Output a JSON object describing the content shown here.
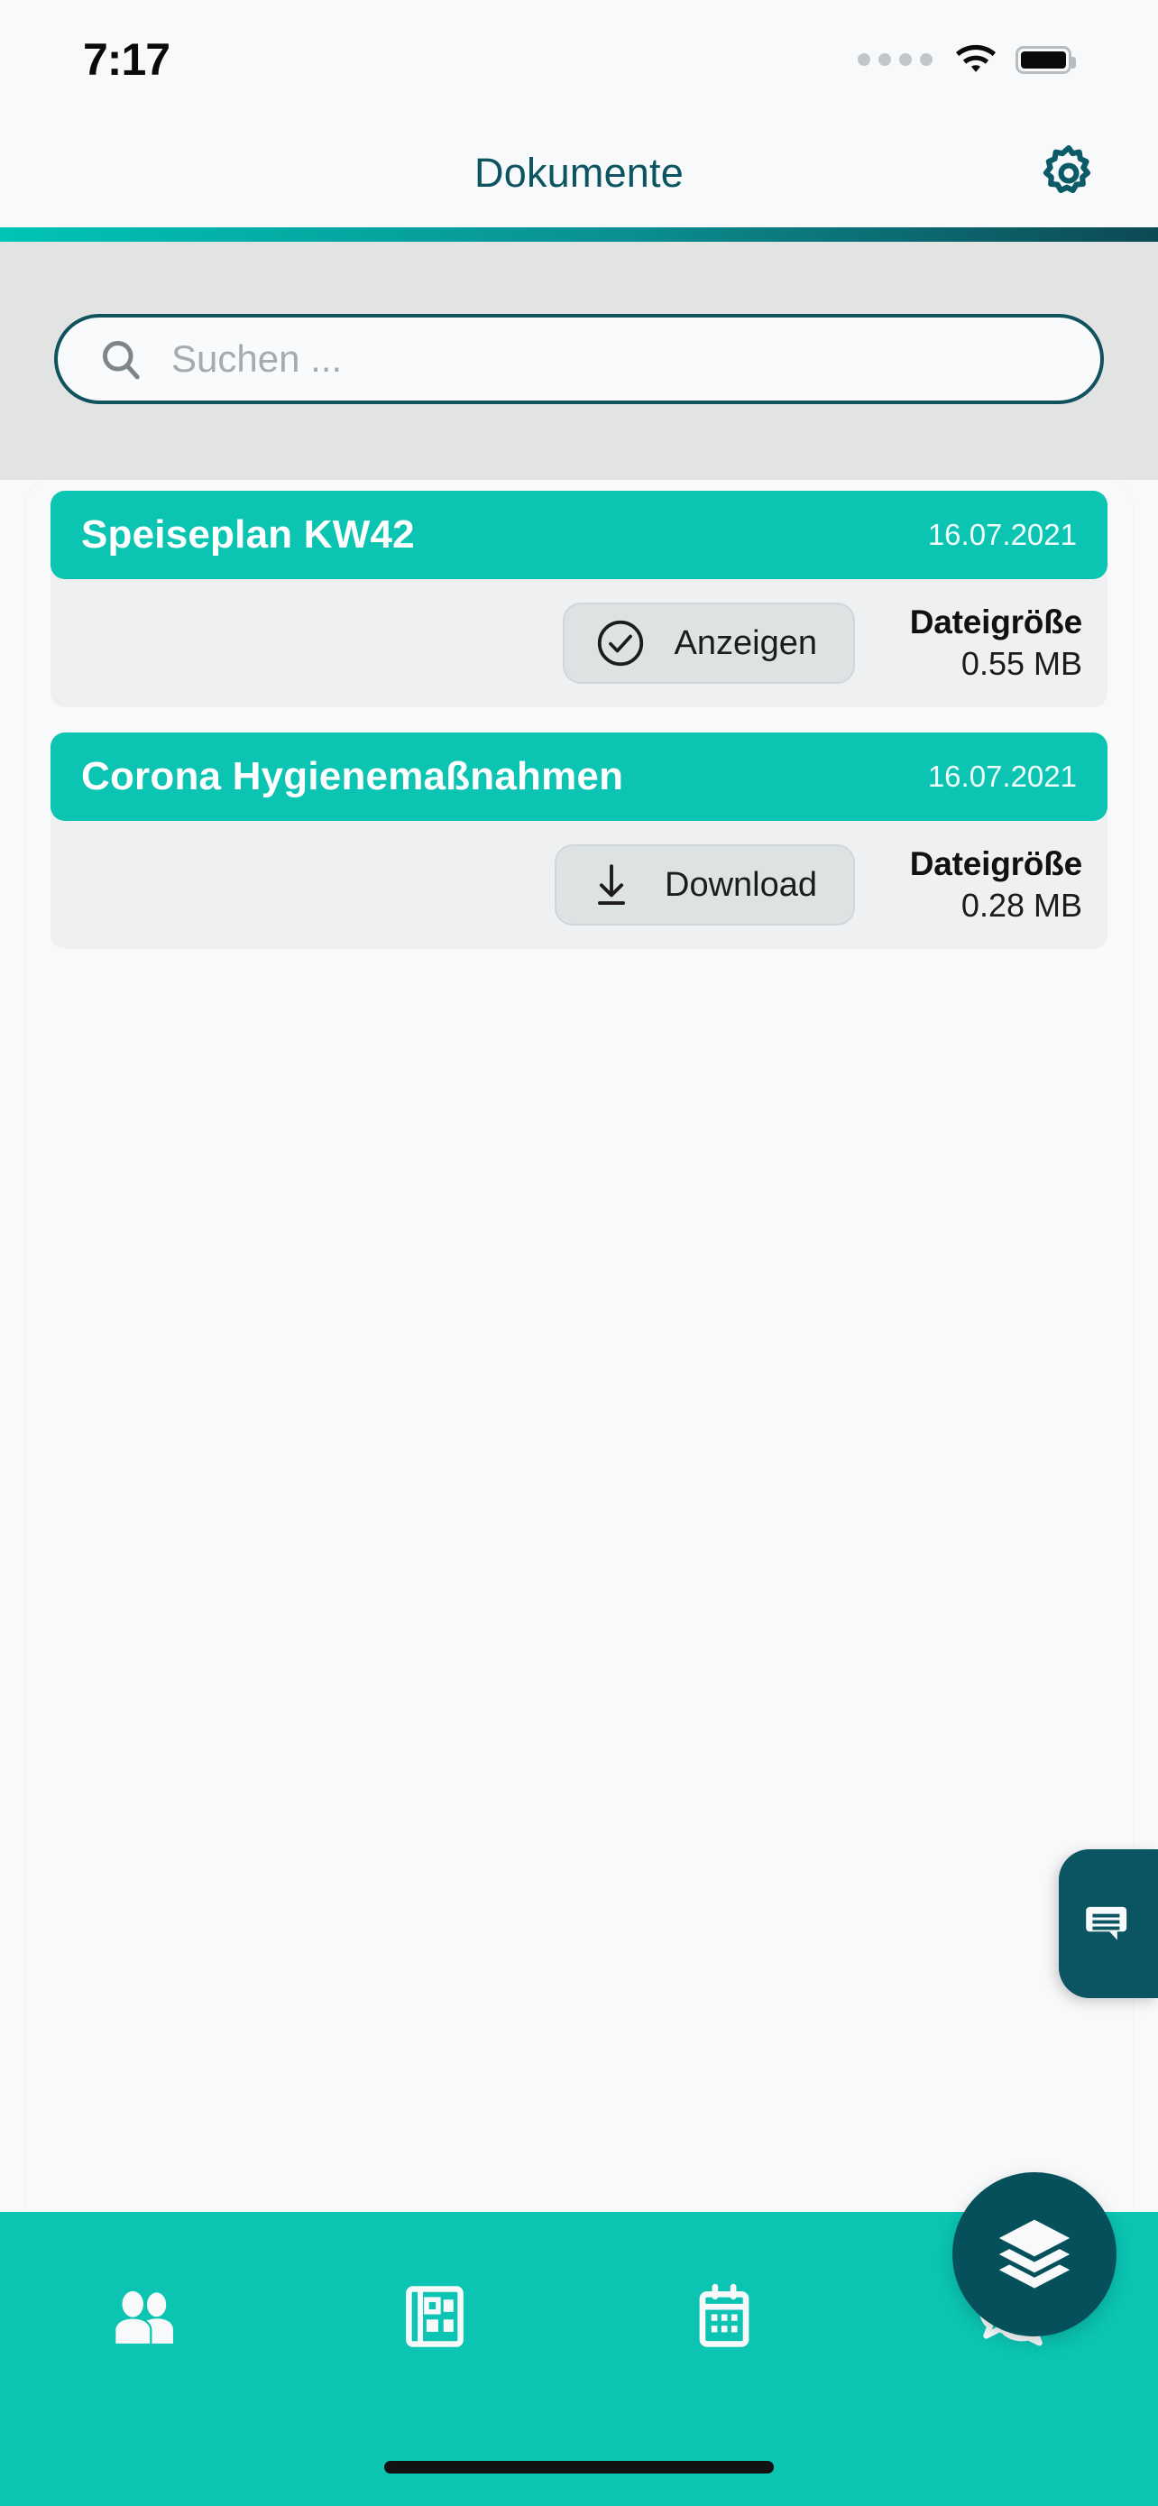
{
  "status_bar": {
    "time": "7:17",
    "signal_icon": "signal-dots-icon",
    "wifi_icon": "wifi-icon",
    "battery_icon": "battery-full-icon"
  },
  "header": {
    "title": "Dokumente",
    "settings_icon": "gear-icon",
    "accent_gradient_from": "#00C4B4",
    "accent_gradient_to": "#0D4954",
    "title_color": "#0D5461"
  },
  "search": {
    "placeholder": "Suchen ...",
    "value": "",
    "icon": "search-icon",
    "border_color": "#11525F"
  },
  "documents": [
    {
      "title": "Speiseplan KW42",
      "date": "16.07.2021",
      "action_label": "Anzeigen",
      "action_icon": "check-circle-icon",
      "size_label": "Dateigröße",
      "size_value": "0.55 MB",
      "header_color": "#0BC4B2"
    },
    {
      "title": "Corona Hygienemaßnahmen",
      "date": "16.07.2021",
      "action_label": "Download",
      "action_icon": "download-icon",
      "size_label": "Dateigröße",
      "size_value": "0.28 MB",
      "header_color": "#0BC4B2"
    }
  ],
  "chat_tab": {
    "icon": "chat-bubble-icon",
    "color": "#0B5461"
  },
  "bottom_nav": {
    "background": "#0BC4B2",
    "items": [
      {
        "icon": "people-group-icon",
        "name": "nav-people"
      },
      {
        "icon": "newspaper-icon",
        "name": "nav-news"
      },
      {
        "icon": "calendar-icon",
        "name": "nav-calendar"
      },
      {
        "icon": "chat-bubbles-icon",
        "name": "nav-messages"
      }
    ],
    "fab": {
      "icon": "layers-stack-icon",
      "color": "#06505C"
    }
  }
}
